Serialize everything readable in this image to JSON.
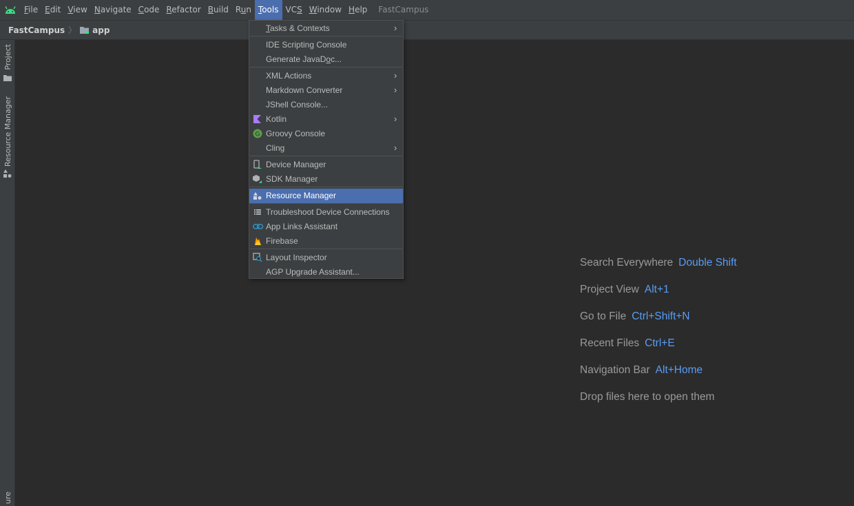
{
  "menubar": {
    "logo_icon": "android-icon",
    "items": [
      {
        "label_pre": "",
        "mnemonic": "F",
        "label_post": "ile"
      },
      {
        "label_pre": "",
        "mnemonic": "E",
        "label_post": "dit"
      },
      {
        "label_pre": "",
        "mnemonic": "V",
        "label_post": "iew"
      },
      {
        "label_pre": "",
        "mnemonic": "N",
        "label_post": "avigate"
      },
      {
        "label_pre": "",
        "mnemonic": "C",
        "label_post": "ode"
      },
      {
        "label_pre": "",
        "mnemonic": "R",
        "label_post": "efactor"
      },
      {
        "label_pre": "",
        "mnemonic": "B",
        "label_post": "uild"
      },
      {
        "label_pre": "R",
        "mnemonic": "u",
        "label_post": "n"
      },
      {
        "label_pre": "",
        "mnemonic": "T",
        "label_post": "ools"
      },
      {
        "label_pre": "VC",
        "mnemonic": "S",
        "label_post": ""
      },
      {
        "label_pre": "",
        "mnemonic": "W",
        "label_post": "indow"
      },
      {
        "label_pre": "",
        "mnemonic": "H",
        "label_post": "elp"
      }
    ],
    "project_title": "FastCampus"
  },
  "navbar": {
    "project": "FastCampus",
    "separator": "〉",
    "module": "app",
    "module_icon": "module-folder-icon"
  },
  "toolstrip": {
    "project_label": "Project",
    "resource_manager_label": "Resource Manager",
    "bottom_label": "ure"
  },
  "tools_menu": {
    "tasks_contexts": {
      "mnemonic": "T",
      "rest": "asks & Contexts"
    },
    "ide_scripting_console": "IDE Scripting Console",
    "generate_javadoc": {
      "pre": "Generate JavaD",
      "mnemonic": "o",
      "post": "c..."
    },
    "xml_actions": "XML Actions",
    "markdown_converter": "Markdown Converter",
    "jshell_console": "JShell Console...",
    "kotlin": "Kotlin",
    "groovy_console": "Groovy Console",
    "cling": "Cling",
    "device_manager": "Device Manager",
    "sdk_manager": "SDK Manager",
    "resource_manager": "Resource Manager",
    "troubleshoot_device_connections": "Troubleshoot Device Connections",
    "app_links_assistant": "App Links Assistant",
    "firebase": "Firebase",
    "layout_inspector": "Layout Inspector",
    "agp_upgrade_assistant": "AGP Upgrade Assistant...",
    "submenu_arrow": "›"
  },
  "hints": [
    {
      "label": "Search Everywhere",
      "key": "Double Shift"
    },
    {
      "label": "Project View",
      "key": "Alt+1"
    },
    {
      "label": "Go to File",
      "key": "Ctrl+Shift+N"
    },
    {
      "label": "Recent Files",
      "key": "Ctrl+E"
    },
    {
      "label": "Navigation Bar",
      "key": "Alt+Home"
    },
    {
      "label": "Drop files here to open them",
      "key": ""
    }
  ],
  "colors": {
    "accent": "#4b6eaf",
    "shortcut": "#589df6",
    "android_green": "#3ddc84"
  }
}
